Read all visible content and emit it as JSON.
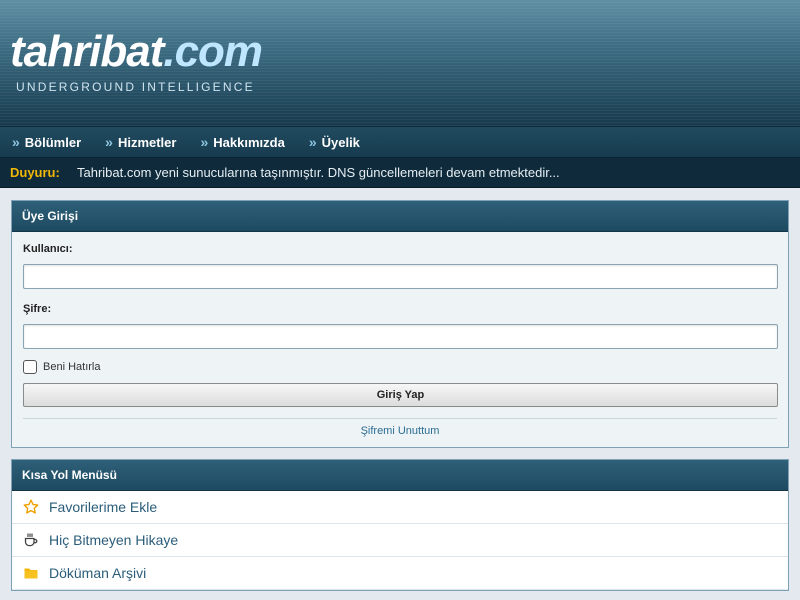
{
  "site": {
    "logo_main": "tahribat",
    "logo_tld": ".com",
    "tagline": "UNDERGROUND INTELLIGENCE"
  },
  "nav": {
    "items": [
      {
        "label": "Bölümler"
      },
      {
        "label": "Hizmetler"
      },
      {
        "label": "Hakkımızda"
      },
      {
        "label": "Üyelik"
      }
    ]
  },
  "announcement": {
    "label": "Duyuru:",
    "text": "Tahribat.com yeni sunucularına taşınmıştır. DNS güncellemeleri devam etmektedir..."
  },
  "login": {
    "title": "Üye Girişi",
    "username_label": "Kullanıcı:",
    "username_value": "",
    "password_label": "Şifre:",
    "password_value": "",
    "remember_label": "Beni Hatırla",
    "remember_checked": false,
    "submit_label": "Giriş Yap",
    "forgot_label": "Şifremi Unuttum"
  },
  "shortcuts": {
    "title": "Kısa Yol Menüsü",
    "items": [
      {
        "label": "Favorilerime Ekle",
        "icon": "star-icon"
      },
      {
        "label": "Hiç Bitmeyen Hikaye",
        "icon": "coffee-cup-icon"
      },
      {
        "label": "Döküman Arşivi",
        "icon": "folder-icon"
      }
    ]
  },
  "colors": {
    "accent": "#1d4a61",
    "announce_label": "#f2b705",
    "link": "#2a6d92"
  }
}
